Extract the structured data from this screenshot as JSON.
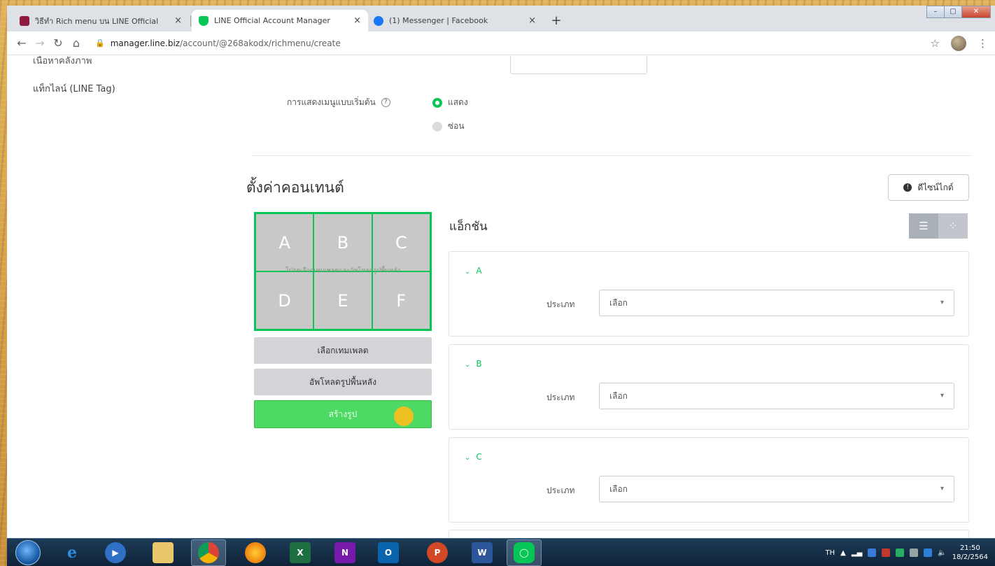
{
  "browser": {
    "tabs": [
      {
        "title": "วิธีทำ Rich menu บน LINE Official",
        "icon": "red-square-icon",
        "color": "#c2185b",
        "active": false
      },
      {
        "title": "LINE Official Account Manager",
        "icon": "line-shield-icon",
        "color": "#06c755",
        "active": true
      },
      {
        "title": "(1) Messenger | Facebook",
        "icon": "facebook-icon",
        "color": "#1877f2",
        "active": false
      }
    ],
    "close_glyph": "×",
    "new_tab_glyph": "+",
    "url_domain": "manager.line.biz",
    "url_path": "/account/@268akodx/richmenu/create"
  },
  "sidebar": {
    "cut_item": "เนื้อหาคลังภาพ",
    "items": [
      {
        "label": "แท็กไลน์ (LINE Tag)"
      }
    ]
  },
  "display": {
    "label": "การแสดงเมนูแบบเริ่มต้น",
    "options": [
      {
        "label": "แสดง",
        "selected": true
      },
      {
        "label": "ซ่อน",
        "selected": false
      }
    ]
  },
  "content_settings": {
    "title": "ตั้งค่าคอนเทนต์",
    "design_guide_label": "ดีไซน์ไกด์",
    "grid_cells": [
      "A",
      "B",
      "C",
      "D",
      "E",
      "F"
    ],
    "grid_overlay_text": "โปรดเลือกเทมเพลตและอัพโหลดรูปพื้นหลัง",
    "select_template_label": "เลือกเทมเพลต",
    "upload_background_label": "อัพโหลดรูปพื้นหลัง",
    "create_image_label": "สร้างรูป"
  },
  "actions": {
    "title": "แอ็กชัน",
    "cards": [
      {
        "letter": "A",
        "type_label": "ประเภท",
        "type_value": "เลือก"
      },
      {
        "letter": "B",
        "type_label": "ประเภท",
        "type_value": "เลือก"
      },
      {
        "letter": "C",
        "type_label": "ประเภท",
        "type_value": "เลือก"
      }
    ]
  },
  "taskbar": {
    "apps": [
      "internet-explorer-icon",
      "media-player-icon",
      "file-explorer-icon",
      "chrome-icon",
      "firefox-icon",
      "excel-icon",
      "onenote-icon",
      "outlook-icon",
      "powerpoint-icon",
      "word-icon",
      "line-app-icon"
    ],
    "language": "TH",
    "time": "21:50",
    "date": "18/2/2564"
  },
  "colors": {
    "line_green": "#06c755",
    "create_button": "#4cd964"
  }
}
